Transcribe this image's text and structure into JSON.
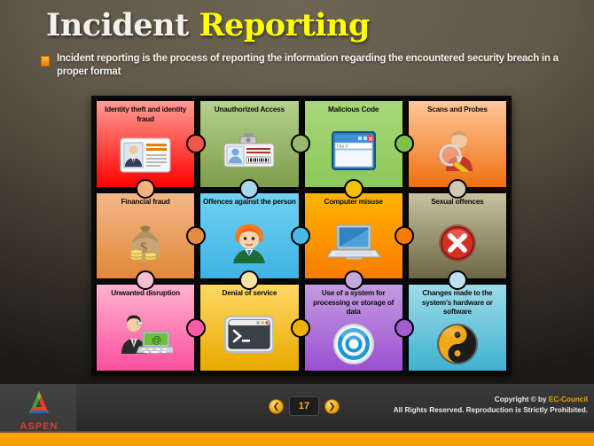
{
  "header": {
    "title_part1": "Incident",
    "title_part2": "Reporting",
    "bullet_text": "Incident reporting is the process of reporting the information regarding the encountered  security breach in a proper format"
  },
  "puzzle": {
    "tiles": [
      {
        "label": "Identity theft and identity fraud",
        "icon": "id-card-icon",
        "color_top": "#ff9d94",
        "color_bottom": "#ff0000",
        "knob_right": "#f0584b",
        "knob_bottom": "#f8b17a"
      },
      {
        "label": "Unauthorized Access",
        "icon": "badge-lock-icon",
        "color_top": "#b6d18c",
        "color_bottom": "#7e9c4a",
        "knob_right": "#9ab96e",
        "knob_bottom": "#a5d8ef"
      },
      {
        "label": "Malicious Code",
        "icon": "browser-window-icon",
        "color_top": "#a8d87a",
        "color_bottom": "#8cc85a",
        "knob_right": "#7fc04e",
        "knob_bottom": "#f2c200"
      },
      {
        "label": "Scans and Probes",
        "icon": "magnifier-person-icon",
        "color_top": "#ffc79a",
        "color_bottom": "#ef7010",
        "knob_right": "#ef7010",
        "knob_bottom": "#cfc9b4"
      },
      {
        "label": "Financial fraud",
        "icon": "money-bag-icon",
        "color_top": "#f3b886",
        "color_bottom": "#e2873a",
        "knob_right": "#e48c3f",
        "knob_bottom": "#f4bfd4"
      },
      {
        "label": "Offences against the person",
        "icon": "person-green-icon",
        "color_top": "#6fd2f4",
        "color_bottom": "#3fb3e2",
        "knob_right": "#49b9e4",
        "knob_bottom": "#fbe3a8"
      },
      {
        "label": "Computer misuse",
        "icon": "laptop-icon",
        "color_top": "#ffb400",
        "color_bottom": "#f97c00",
        "knob_right": "#f97c00",
        "knob_bottom": "#c3aadc"
      },
      {
        "label": "Sexual offences",
        "icon": "red-x-icon",
        "color_top": "#c9c2a0",
        "color_bottom": "#6d6646",
        "knob_right": "#8e875f",
        "knob_bottom": "#bfe0ee"
      },
      {
        "label": "Unwanted disruption",
        "icon": "person-laptop-mail-icon",
        "color_top": "#ffb3cd",
        "color_bottom": "#fb4fa0",
        "knob_right": "#fb5ba5",
        "knob_bottom": ""
      },
      {
        "label": "Denial of service",
        "icon": "terminal-icon",
        "color_top": "#ffd865",
        "color_bottom": "#e8a900",
        "knob_right": "#edb100",
        "knob_bottom": ""
      },
      {
        "label": "Use of a system for processing or storage of data",
        "icon": "target-rings-icon",
        "color_top": "#c49de0",
        "color_bottom": "#9b4fd0",
        "knob_right": "#a35dd4",
        "knob_bottom": ""
      },
      {
        "label": "Changes made to the system's hardware or software",
        "icon": "yin-yang-icon",
        "color_top": "#9fdbe9",
        "color_bottom": "#3fb2cf",
        "knob_right": "",
        "knob_bottom": ""
      }
    ]
  },
  "footer": {
    "logo_name": "ASPEN",
    "prev_label": "❮",
    "next_label": "❯",
    "page_number": "17",
    "copyright_line1_prefix": "Copyright © by ",
    "copyright_brand": "EC-Council",
    "copyright_line2": "All Rights Reserved.  Reproduction is Strictly Prohibited."
  }
}
